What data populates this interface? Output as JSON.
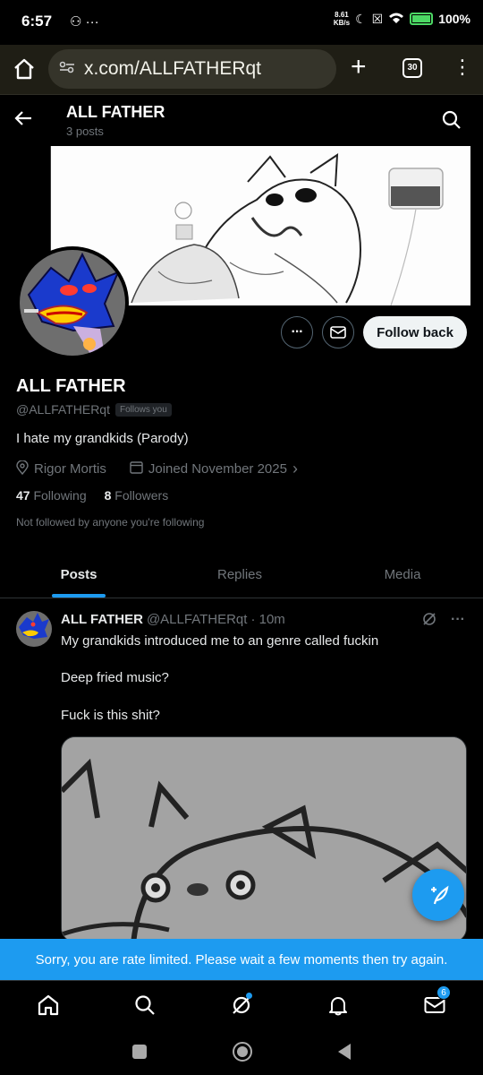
{
  "status": {
    "time": "6:57",
    "left_icons": "⚇ ···",
    "net_speed_top": "8.61",
    "net_speed_bottom": "KB/s",
    "battery": "100%"
  },
  "browser": {
    "url": "x.com/ALLFATHERqt",
    "tab_count": "30"
  },
  "header": {
    "name": "ALL FATHER",
    "posts": "3 posts"
  },
  "profile": {
    "name": "ALL FATHER",
    "handle": "@ALLFATHERqt",
    "follows_you": "Follows you",
    "bio": "I hate my grandkids (Parody)",
    "location": "Rigor Mortis",
    "joined": "Joined November 2025",
    "following_count": "47",
    "following_label": "Following",
    "followers_count": "8",
    "followers_label": "Followers",
    "not_followed": "Not followed by anyone you're following",
    "follow_back": "Follow back"
  },
  "tabs": [
    "Posts",
    "Replies",
    "Media"
  ],
  "post": {
    "name": "ALL FATHER",
    "handle": "@ALLFATHERqt",
    "time": "· 10m",
    "line1": "My grandkids introduced me to an genre called fuckin",
    "line2": "Deep fried music?",
    "line3": "Fuck is this shit?"
  },
  "rate_limit": "Sorry, you are rate limited. Please wait a few moments then try again.",
  "messages_badge": "6",
  "colors": {
    "accent": "#1d9bf0",
    "background": "#000000",
    "muted": "#71767b"
  }
}
